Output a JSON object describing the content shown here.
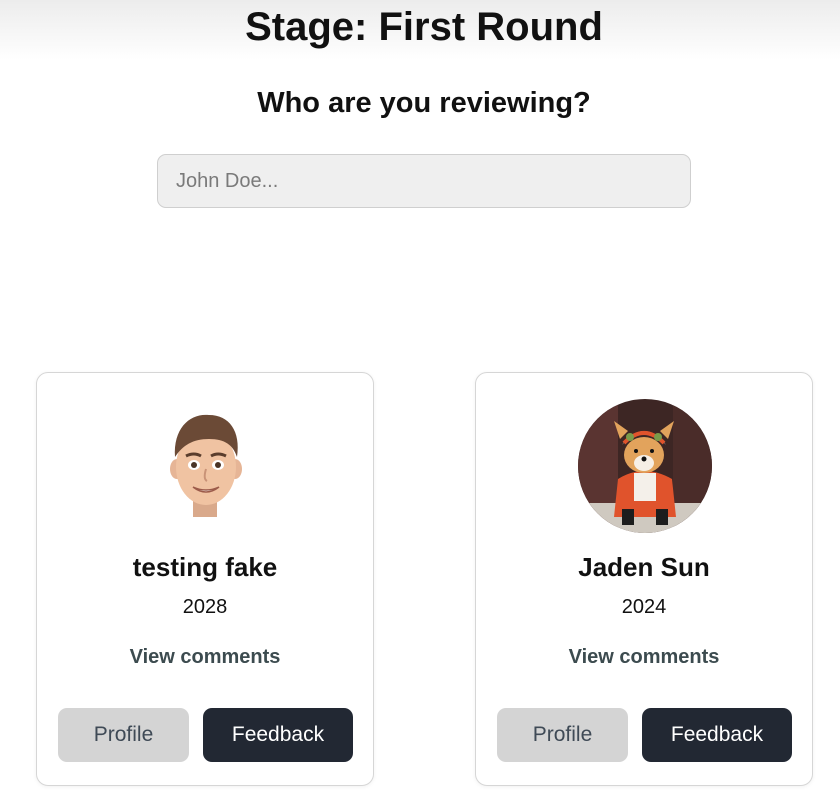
{
  "header": {
    "stage_title": "Stage: First Round",
    "question": "Who are you reviewing?"
  },
  "search": {
    "value": "",
    "placeholder": "John Doe..."
  },
  "candidates": [
    {
      "name": "testing fake",
      "year": "2028",
      "avatar_icon": "memoji-avatar-icon",
      "view_comments_label": "View comments",
      "profile_label": "Profile",
      "feedback_label": "Feedback"
    },
    {
      "name": "Jaden Sun",
      "year": "2024",
      "avatar_icon": "corgi-photo-avatar-icon",
      "view_comments_label": "View comments",
      "profile_label": "Profile",
      "feedback_label": "Feedback"
    }
  ],
  "colors": {
    "feedback_button_bg": "#222833",
    "profile_button_bg": "#d4d4d4",
    "link_text": "#3c4b4f",
    "input_bg": "#efefef"
  }
}
